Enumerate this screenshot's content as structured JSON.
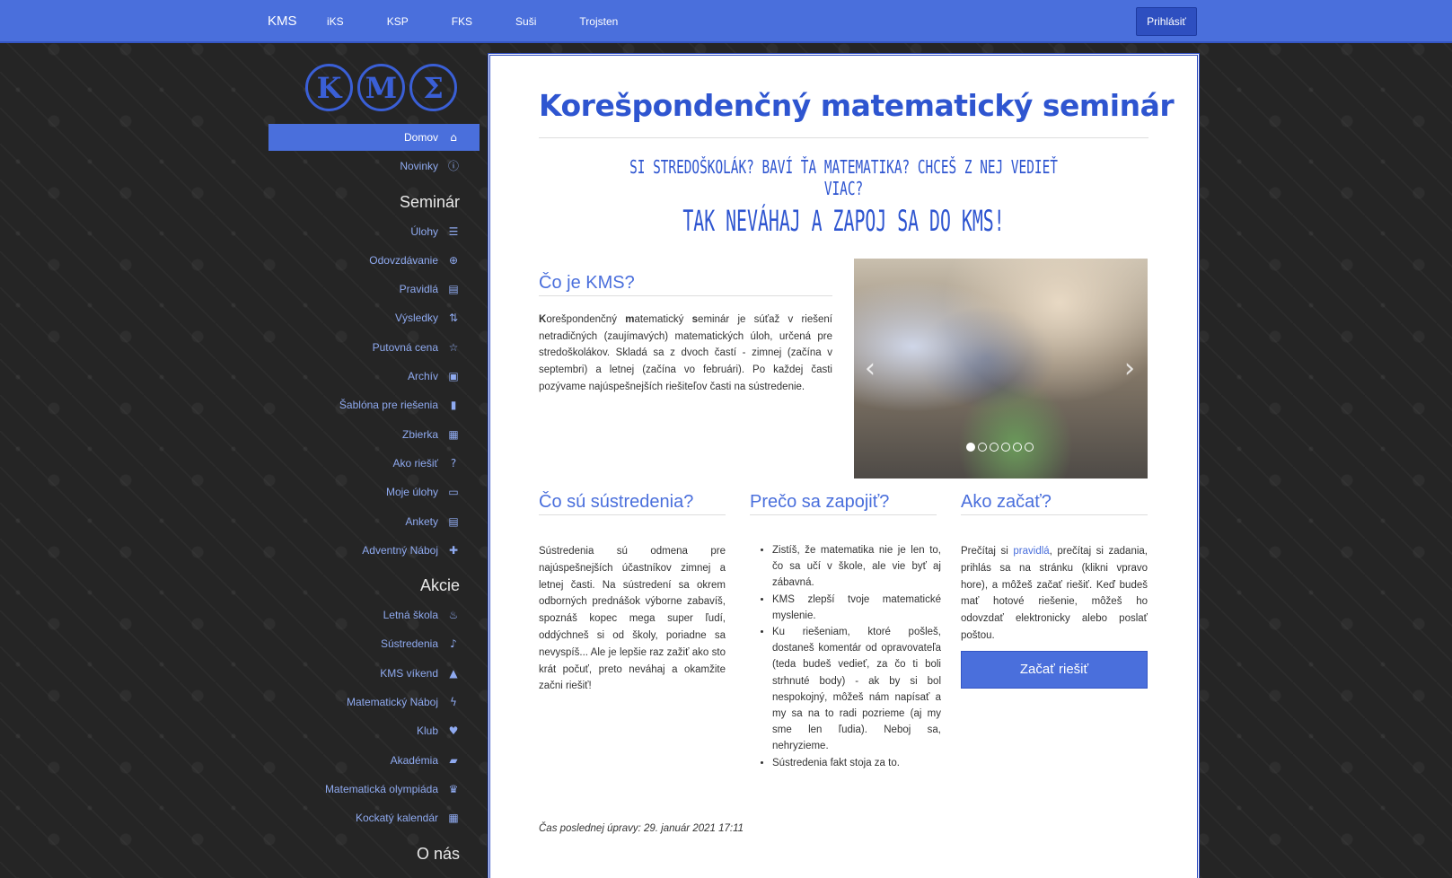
{
  "navbar": {
    "brand": "KMS",
    "links": [
      "iKS",
      "KSP",
      "FKS",
      "Suši",
      "Trojsten"
    ],
    "login": "Prihlásiť",
    "color": "#4a6fdc"
  },
  "sidebar": {
    "logo_letters": [
      "K",
      "M",
      "Σ"
    ],
    "items_top": [
      {
        "label": "Domov",
        "icon": "home-icon",
        "active": true
      },
      {
        "label": "Novinky",
        "icon": "info-icon"
      }
    ],
    "heading_seminar": "Seminár",
    "items_seminar": [
      {
        "label": "Úlohy",
        "icon": "list-icon"
      },
      {
        "label": "Odovzdávanie",
        "icon": "upload-icon"
      },
      {
        "label": "Pravidlá",
        "icon": "document-icon"
      },
      {
        "label": "Výsledky",
        "icon": "sort-icon"
      },
      {
        "label": "Putovná cena",
        "icon": "star-icon"
      },
      {
        "label": "Archív",
        "icon": "inbox-icon"
      },
      {
        "label": "Šablóna pre riešenia",
        "icon": "file-icon"
      },
      {
        "label": "Zbierka",
        "icon": "book-icon"
      },
      {
        "label": "Ako riešiť",
        "icon": "question-icon"
      },
      {
        "label": "Moje úlohy",
        "icon": "folder-icon"
      },
      {
        "label": "Ankety",
        "icon": "list-alt-icon"
      },
      {
        "label": "Adventný Náboj",
        "icon": "gift-icon"
      }
    ],
    "heading_akcie": "Akcie",
    "items_akcie": [
      {
        "label": "Letná škola",
        "icon": "fire-icon"
      },
      {
        "label": "Sústredenia",
        "icon": "bell-icon"
      },
      {
        "label": "KMS víkend",
        "icon": "tent-icon"
      },
      {
        "label": "Matematický Náboj",
        "icon": "bolt-icon"
      },
      {
        "label": "Klub",
        "icon": "heart-icon"
      },
      {
        "label": "Akadémia",
        "icon": "briefcase-icon"
      },
      {
        "label": "Matematická olympiáda",
        "icon": "crown-icon"
      },
      {
        "label": "Kockatý kalendár",
        "icon": "calendar-icon"
      }
    ],
    "heading_onas": "O nás"
  },
  "main": {
    "title": "Korešpondenčný matematický seminár",
    "tagline1": "Si stredoškolák? Baví ťa matematika? Chceš z nej vedieť viac?",
    "tagline2": "Tak neváhaj a zapoj sa do KMS!",
    "what_is": {
      "heading": "Čo je KMS?",
      "k": "K",
      "t1": "orešpondenčný ",
      "m": "m",
      "t2": "atematický ",
      "s": "s",
      "t3": "eminár je súťaž v riešení netradičných (zaujímavých) matematických úloh, určená pre stredoškolákov. Skladá sa z dvoch častí - zimnej (začína v septembri) a letnej (začína vo februári). Po každej časti pozývame najúspešnejších riešiteľov časti na sústredenie."
    },
    "carousel": {
      "slides": 6,
      "active": 0
    },
    "camps": {
      "heading": "Čo sú sústredenia?",
      "text": "Sústredenia sú odmena pre najúspešnejších účastníkov zimnej a letnej časti. Na sústredení sa okrem odborných prednášok výborne zabavíš, spoznáš kopec mega super ľudí, oddýchneš si od školy, poriadne sa nevyspíš... Ale je lepšie raz zažiť ako sto krát počuť, preto neváhaj a okamžite začni riešiť!"
    },
    "why": {
      "heading": "Prečo sa zapojiť?",
      "bullets": [
        "Zistíš, že matematika nie je len to, čo sa učí v škole, ale vie byť aj zábavná.",
        "KMS zlepší tvoje matematické myslenie.",
        "Ku riešeniam, ktoré pošleš, dostaneš komentár od opravovateľa (teda budeš vedieť, za čo ti boli strhnuté body) - ak by si bol nespokojný, môžeš nám napísať a my sa na to radi pozrieme (aj my sme len ľudia). Neboj sa, nehryzieme.",
        "Sústredenia fakt stoja za to."
      ]
    },
    "start": {
      "heading": "Ako začať?",
      "t1": "Prečítaj si ",
      "link": "pravidlá",
      "t2": ", prečítaj si zadania, prihlás sa na stránku (klikni vpravo hore), a môžeš začať riešiť. Keď budeš mať hotové riešenie, môžeš ho odovzdať elektronicky alebo poslať poštou.",
      "button": "Začať riešiť"
    },
    "modified": "Čas poslednej úpravy: 29. január 2021 17:11"
  }
}
